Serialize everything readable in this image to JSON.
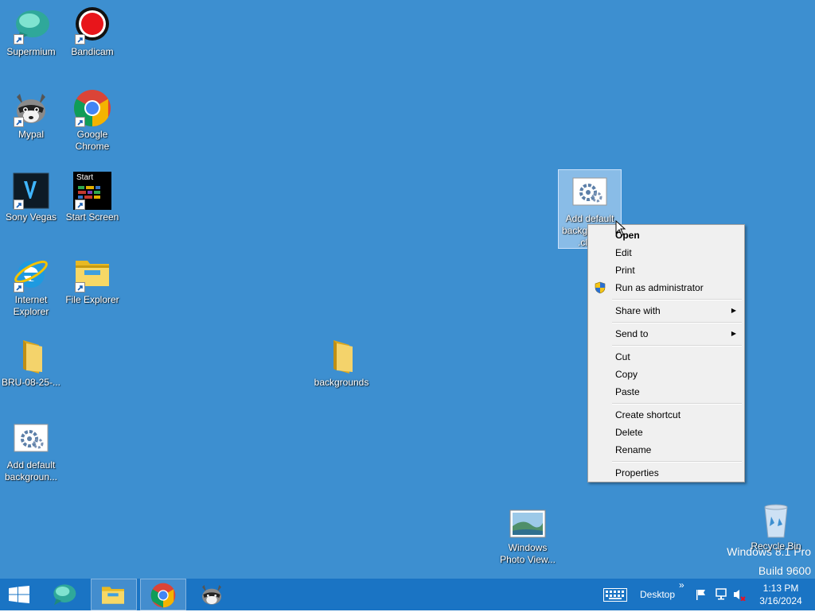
{
  "desktop_icons": {
    "supermium": {
      "label": "Supermium"
    },
    "bandicam": {
      "label": "Bandicam"
    },
    "mypal": {
      "label": "Mypal"
    },
    "chrome": {
      "label": "Google Chrome"
    },
    "sony_vegas": {
      "label": "Sony Vegas"
    },
    "start_screen": {
      "label": "Start Screen",
      "thumb_text": "Start"
    },
    "internet_explorer": {
      "label": "Internet Explorer"
    },
    "file_explorer": {
      "label": "File Explorer"
    },
    "bru_folder": {
      "label": "BRU-08-25-..."
    },
    "backgrounds_folder": {
      "label": "backgrounds"
    },
    "add_default_bg_left": {
      "label": "Add default backgroun..."
    },
    "add_default_bg_selected": {
      "label_line1": "Add default",
      "label_line2": "backg",
      "label_line3": ".cl"
    },
    "photo_viewer": {
      "label": "Windows Photo View..."
    },
    "recycle_bin": {
      "label": "Recycle Bin"
    }
  },
  "context_menu": {
    "open": "Open",
    "edit": "Edit",
    "print": "Print",
    "run_as_admin": "Run as administrator",
    "share_with": "Share with",
    "send_to": "Send to",
    "cut": "Cut",
    "copy": "Copy",
    "paste": "Paste",
    "create_shortcut": "Create shortcut",
    "delete": "Delete",
    "rename": "Rename",
    "properties": "Properties",
    "submenu_arrow": "▶"
  },
  "watermark": {
    "line1": "Windows 8.1 Pro",
    "line2": "Build 9600"
  },
  "taskbar": {
    "toolbar_label": "Desktop",
    "chevron": "»",
    "time": "1:13 PM",
    "date": "3/16/2024"
  },
  "colors": {
    "desktop": "#3d8fd0",
    "taskbar": "#1a74c4"
  }
}
